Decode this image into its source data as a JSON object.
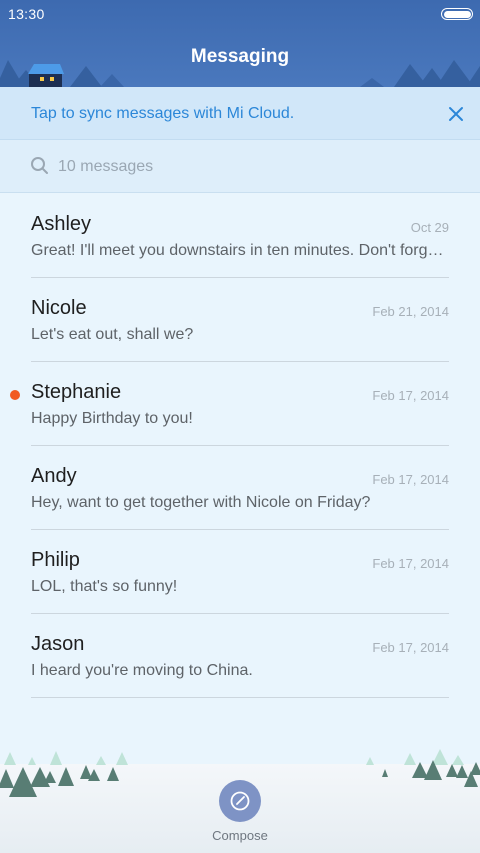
{
  "status_bar": {
    "time": "13:30",
    "battery_level": 1.0
  },
  "header": {
    "title": "Messaging"
  },
  "sync_banner": {
    "text": "Tap to sync messages with Mi Cloud."
  },
  "search": {
    "label": "10 messages"
  },
  "messages": [
    {
      "name": "Ashley",
      "date": "Oct 29",
      "preview": "Great! I'll meet you downstairs in ten minutes. Don't forget the tickets!",
      "unread": false
    },
    {
      "name": "Nicole",
      "date": "Feb 21, 2014",
      "preview": "Let's eat out, shall we?",
      "unread": false
    },
    {
      "name": "Stephanie",
      "date": "Feb 17, 2014",
      "preview": "Happy Birthday to you!",
      "unread": true
    },
    {
      "name": "Andy",
      "date": "Feb 17, 2014",
      "preview": "Hey, want to get together with Nicole on Friday?",
      "unread": false
    },
    {
      "name": "Philip",
      "date": "Feb 17, 2014",
      "preview": "LOL, that's so funny!",
      "unread": false
    },
    {
      "name": "Jason",
      "date": "Feb 17, 2014",
      "preview": "I heard you're moving to China.",
      "unread": false
    }
  ],
  "footer": {
    "compose_label": "Compose"
  },
  "colors": {
    "header": "#4a78bd",
    "accent": "#2c87d8",
    "unread_dot": "#f15a22",
    "compose_button": "#7e93c5"
  }
}
